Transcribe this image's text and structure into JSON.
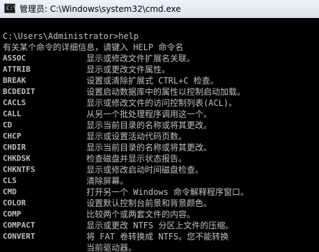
{
  "window": {
    "title": "管理员: C:\\Windows\\system32\\cmd.exe",
    "icon": "cmd-icon",
    "icon_text": "C:\\"
  },
  "console": {
    "prompt_line": "C:\\Users\\Administrator>help",
    "intro_line": "有关某个命令的详细信息，请键入 HELP 命令名",
    "commands": [
      {
        "name": "ASSOC",
        "desc": "显示或修改文件扩展名关联。"
      },
      {
        "name": "ATTRIB",
        "desc": "显示或更改文件属性。"
      },
      {
        "name": "BREAK",
        "desc": "设置或清除扩展式 CTRL+C 检查。"
      },
      {
        "name": "BCDEDIT",
        "desc": "设置启动数据库中的属性以控制启动加载。"
      },
      {
        "name": "CACLS",
        "desc": "显示或修改文件的访问控制列表(ACL)。"
      },
      {
        "name": "CALL",
        "desc": "从另一个批处理程序调用这一个。"
      },
      {
        "name": "CD",
        "desc": "显示当前目录的名称或将其更改。"
      },
      {
        "name": "CHCP",
        "desc": "显示或设置活动代码页数。"
      },
      {
        "name": "CHDIR",
        "desc": "显示当前目录的名称或将其更改。"
      },
      {
        "name": "CHKDSK",
        "desc": "检查磁盘并显示状态报告。"
      },
      {
        "name": "CHKNTFS",
        "desc": "显示或修改启动时间磁盘检查。"
      },
      {
        "name": "CLS",
        "desc": "清除屏幕。"
      },
      {
        "name": "CMD",
        "desc": "打开另一个 Windows 命令解释程序窗口。"
      },
      {
        "name": "COLOR",
        "desc": "设置默认控制台前景和背景颜色。"
      },
      {
        "name": "COMP",
        "desc": "比较两个或两套文件的内容。"
      },
      {
        "name": "COMPACT",
        "desc": "显示或更改 NTFS 分区上文件的压缩。"
      },
      {
        "name": "CONVERT",
        "desc": "将 FAT 卷转换成 NTFS。您不能转换"
      }
    ],
    "continuation_line": "当前驱动器。"
  }
}
